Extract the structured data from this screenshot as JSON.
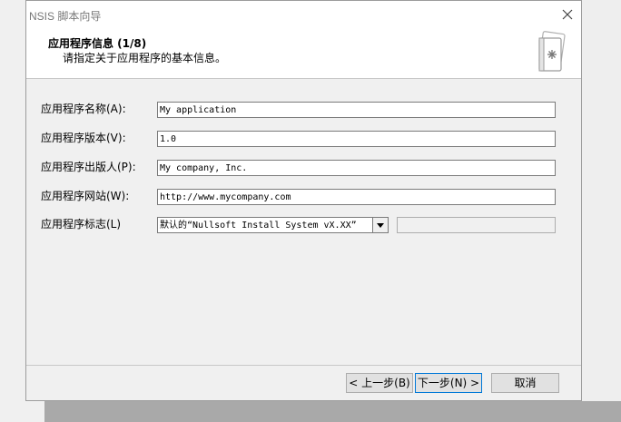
{
  "window": {
    "title": "NSIS 脚本向导"
  },
  "header": {
    "title": "应用程序信息 (1/8)",
    "subtitle": "请指定关于应用程序的基本信息。"
  },
  "form": {
    "name_label": "应用程序名称(A):",
    "name_value": "My application",
    "version_label": "应用程序版本(V):",
    "version_value": "1.0",
    "publisher_label": "应用程序出版人(P):",
    "publisher_value": "My company, Inc.",
    "website_label": "应用程序网站(W):",
    "website_value": "http://www.mycompany.com",
    "branding_label": "应用程序标志(L)",
    "branding_value": "默认的“Nullsoft Install System vX.XX”"
  },
  "buttons": {
    "back": "< 上一步(B)",
    "next": "下一步(N) >",
    "cancel": "取消"
  },
  "icons": {
    "close": "close-icon",
    "wizard": "wizard-document-icon",
    "dropdown": "chevron-down-icon"
  }
}
